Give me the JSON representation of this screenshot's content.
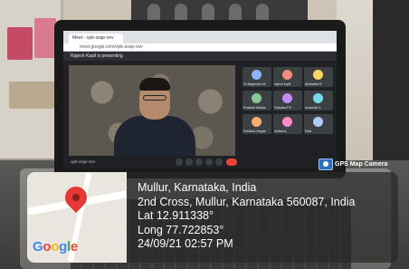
{
  "meet": {
    "tab_title": "Meet - opb-ssqe-vev",
    "address": "meet.google.com/opb-ssqe-vev",
    "presenting": "Rajesh Kapil is presenting",
    "meeting_code": "opb-ssqe-vev",
    "participants": [
      "Dr.Nagendra M",
      "rajesh kapil",
      "Akshatha R",
      "Prakash Mallya",
      "Deepika PS",
      "Aravinda S",
      "Pavithra Hegde",
      "Anitha A",
      "Ravi"
    ]
  },
  "overlay": {
    "camera_app": "GPS Map Camera",
    "city": "Mullur, Karnataka, India",
    "address": "2nd Cross, Mullur, Karnataka 560087, India",
    "lat": "Lat 12.911338°",
    "long": "Long 77.722853°",
    "datetime": "24/09/21 02:57 PM",
    "brand": "Google"
  },
  "colors": {
    "google_blue": "#4285F4",
    "google_red": "#EA4335",
    "google_yellow": "#FBBC05",
    "google_green": "#34A853",
    "pin_red": "#e53935"
  }
}
